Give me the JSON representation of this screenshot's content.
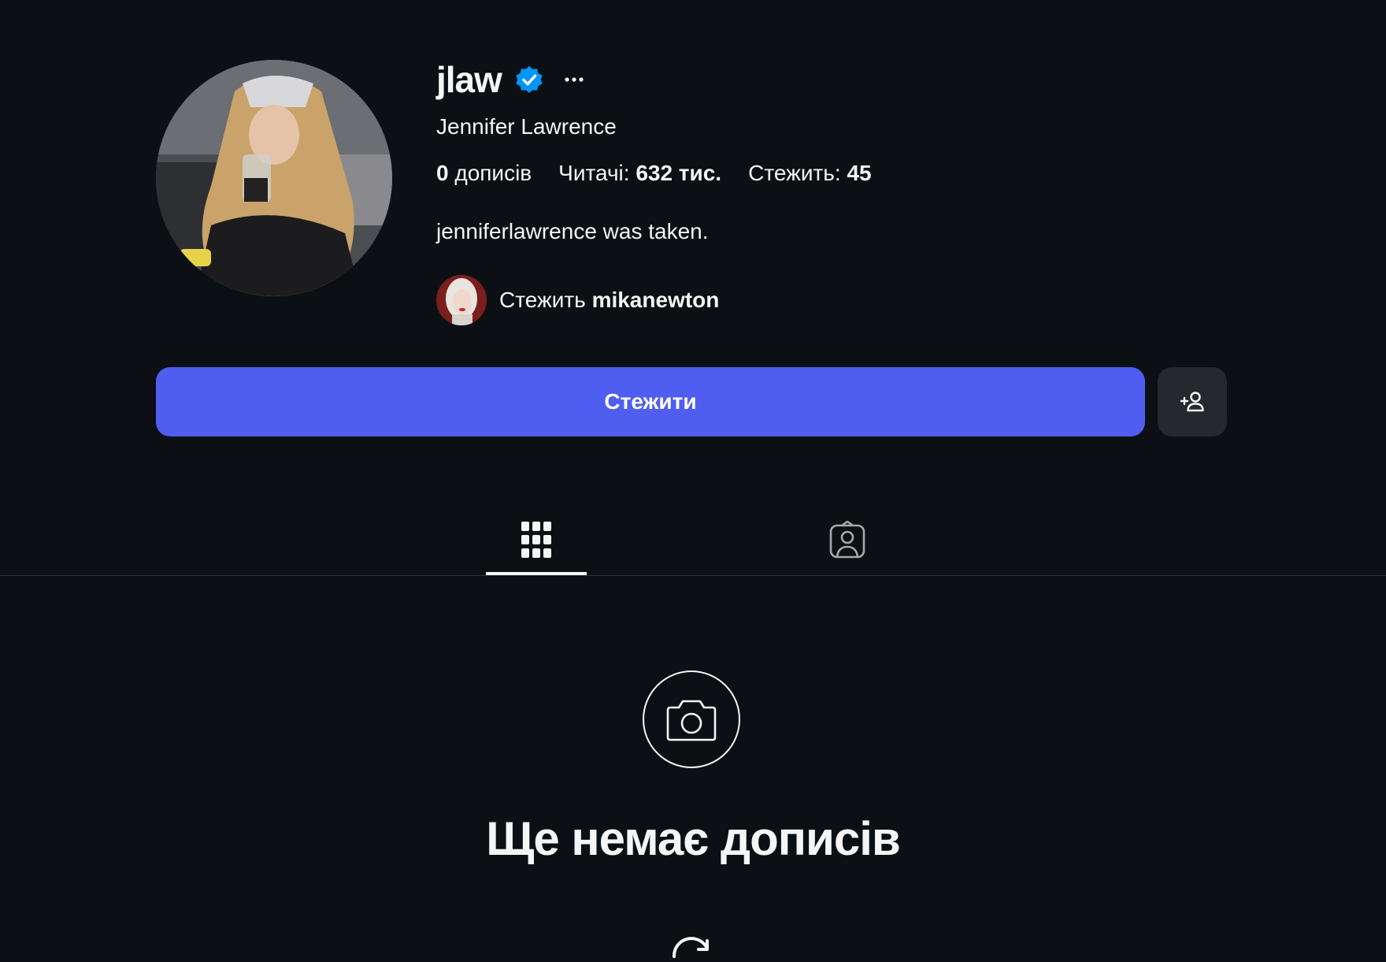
{
  "profile": {
    "username": "jlaw",
    "full_name": "Jennifer Lawrence",
    "verified": true,
    "bio": "jenniferlawrence was taken."
  },
  "stats": {
    "posts_count": "0",
    "posts_label": "дописів",
    "followers_label": "Читачі:",
    "followers_count": "632 тис.",
    "following_label": "Стежить:",
    "following_count": "45"
  },
  "followed_by": {
    "prefix": "Стежить",
    "username": "mikanewton"
  },
  "actions": {
    "follow_label": "Стежити"
  },
  "tabs": [
    {
      "name": "posts",
      "icon": "grid-icon",
      "active": true
    },
    {
      "name": "tagged",
      "icon": "tagged-person-icon",
      "active": false
    }
  ],
  "empty_state": {
    "icon": "camera-icon",
    "title": "Ще немає дописів"
  },
  "colors": {
    "background": "#0c1014",
    "accent": "#4f5ef0",
    "verified": "#0095f6",
    "secondary_button": "#25292e"
  }
}
